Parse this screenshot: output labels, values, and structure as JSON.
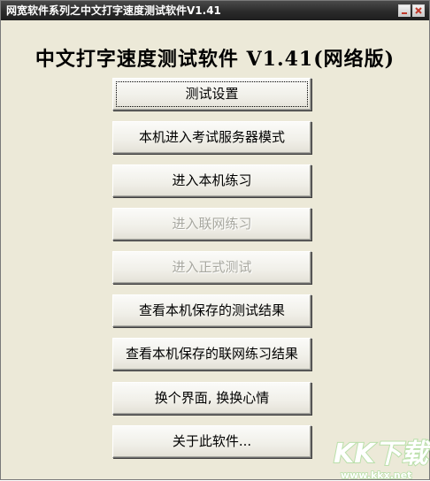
{
  "window": {
    "title": "网宽软件系列之中文打字速度测试软件V1.41"
  },
  "app": {
    "heading": "中文打字速度测试软件 V1.41(网络版)"
  },
  "buttons": [
    {
      "label": "测试设置",
      "enabled": true
    },
    {
      "label": "本机进入考试服务器模式",
      "enabled": true
    },
    {
      "label": "进入本机练习",
      "enabled": true
    },
    {
      "label": "进入联网练习",
      "enabled": false
    },
    {
      "label": "进入正式测试",
      "enabled": false
    },
    {
      "label": "查看本机保存的测试结果",
      "enabled": true
    },
    {
      "label": "查看本机保存的联网练习结果",
      "enabled": true
    },
    {
      "label": "换个界面, 换换心情",
      "enabled": true
    },
    {
      "label": "关于此软件...",
      "enabled": true
    }
  ],
  "watermark": {
    "logo_text": "KK下载",
    "url": "www.kkx.net"
  },
  "colors": {
    "window_bg": "#ece9d8",
    "titlebar": "#2b2b2b",
    "watermark": "#b9dfa9"
  },
  "icons": {
    "minimize": "minimize-icon",
    "close": "close-icon"
  }
}
